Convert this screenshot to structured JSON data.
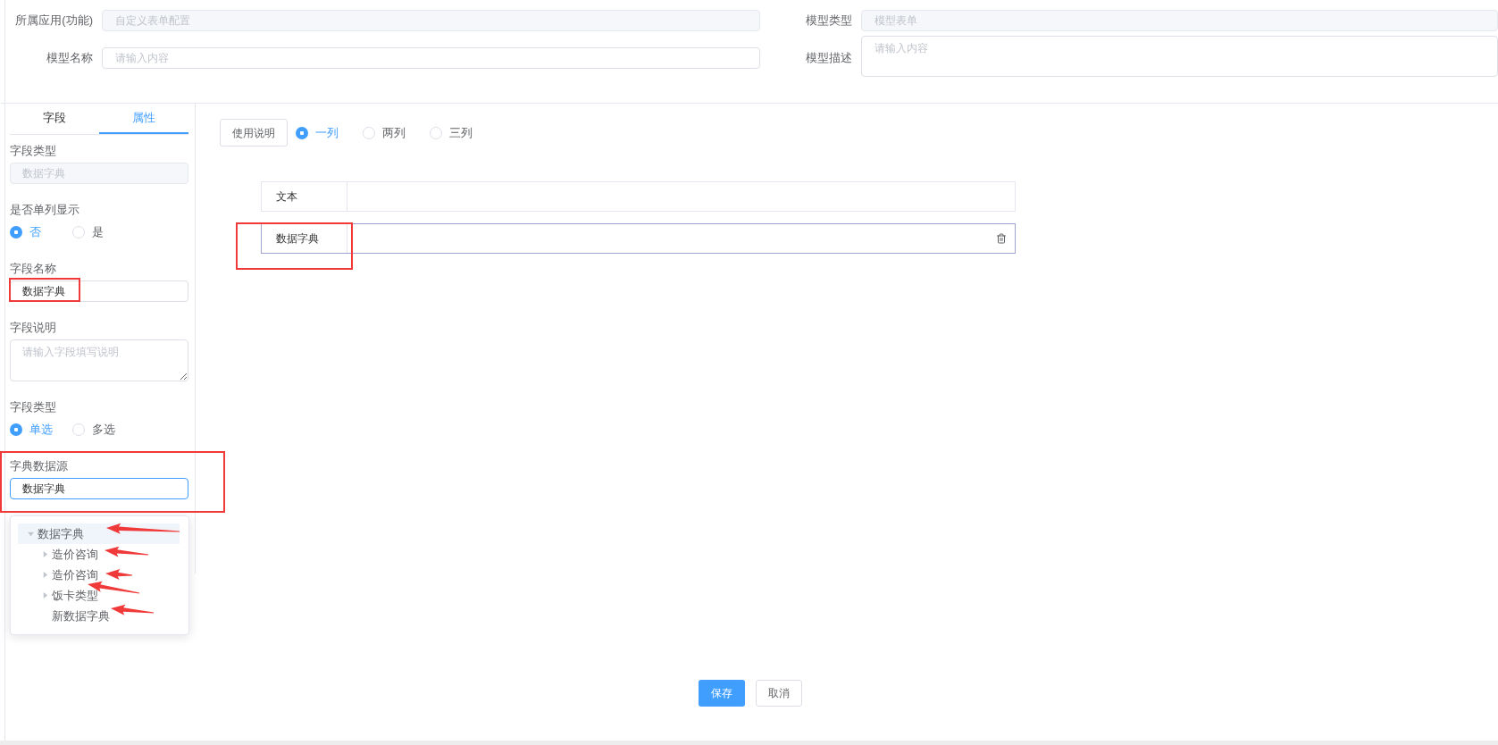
{
  "form_rows": [
    {
      "fields": [
        {
          "label": "所属应用(功能)",
          "value": "自定义表单配置",
          "disabled": true,
          "kind": "input"
        },
        {
          "label": "模型类型",
          "value": "模型表单",
          "disabled": true,
          "kind": "input"
        }
      ]
    },
    {
      "fields": [
        {
          "label": "模型名称",
          "placeholder": "请输入内容",
          "kind": "input"
        },
        {
          "label": "模型描述",
          "placeholder": "请输入内容",
          "kind": "textarea"
        }
      ]
    }
  ],
  "sidebar": {
    "tabs": [
      {
        "label": "字段",
        "selected": false
      },
      {
        "label": "属性",
        "selected": true
      }
    ],
    "properties": [
      {
        "kind": "input",
        "label": "字段类型",
        "value": "数据字典",
        "disabled": true,
        "focused": false
      },
      {
        "kind": "radio",
        "label": "是否单列显示",
        "options": [
          {
            "label": "否",
            "selected": true
          },
          {
            "label": "是",
            "selected": false
          }
        ]
      },
      {
        "kind": "input",
        "label": "字段名称",
        "value": "数据字典",
        "disabled": false,
        "focused": false
      },
      {
        "kind": "textarea",
        "label": "字段说明",
        "placeholder": "请输入字段填写说明"
      },
      {
        "kind": "radio",
        "label": "字段类型",
        "options": [
          {
            "label": "单选",
            "selected": true
          },
          {
            "label": "多选",
            "selected": false
          }
        ]
      },
      {
        "kind": "input",
        "label": "字典数据源",
        "value": "数据字典",
        "disabled": false,
        "focused": true
      }
    ],
    "dropdown_tree": [
      {
        "label": "数据字典",
        "kind": "branch",
        "expanded": true,
        "selected": true,
        "children": [
          {
            "label": "造价咨询",
            "kind": "branch",
            "expanded": false,
            "selected": false
          },
          {
            "label": "造价咨询",
            "kind": "branch",
            "expanded": false,
            "selected": false
          },
          {
            "label": "饭卡类型",
            "kind": "branch",
            "expanded": false,
            "selected": false
          },
          {
            "label": "新数据字典",
            "kind": "leaf",
            "expanded": false,
            "selected": false
          }
        ]
      }
    ]
  },
  "toolbar": {
    "help_button": "使用说明",
    "layouts": [
      {
        "label": "一列",
        "selected": true
      },
      {
        "label": "两列",
        "selected": false
      },
      {
        "label": "三列",
        "selected": false
      }
    ]
  },
  "canvas_rows": [
    {
      "label": "文本",
      "selected": false
    },
    {
      "label": "数据字典",
      "selected": true
    }
  ],
  "footer_buttons": [
    {
      "label": "保存",
      "kind": "primary"
    },
    {
      "label": "取消",
      "kind": "default"
    }
  ]
}
